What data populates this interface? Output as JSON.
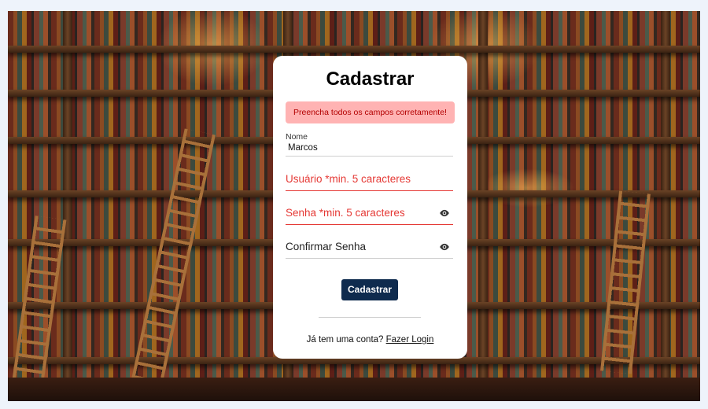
{
  "form": {
    "title": "Cadastrar",
    "alert": "Preencha todos os campos corretamente!",
    "name_label": "Nome",
    "name_value": "Marcos",
    "user_placeholder": "Usuário *min. 5 caracteres",
    "password_placeholder": "Senha *min. 5 caracteres",
    "confirm_placeholder": "Confirmar Senha",
    "submit_label": "Cadastrar",
    "footer_text": "Já tem uma conta?",
    "login_link": "Fazer Login"
  },
  "colors": {
    "button": "#0f2b4e",
    "error": "#e53935",
    "alert_bg": "#ffb3b3"
  },
  "icons": {
    "password_toggle": "eye-icon",
    "confirm_toggle": "eye-icon"
  }
}
